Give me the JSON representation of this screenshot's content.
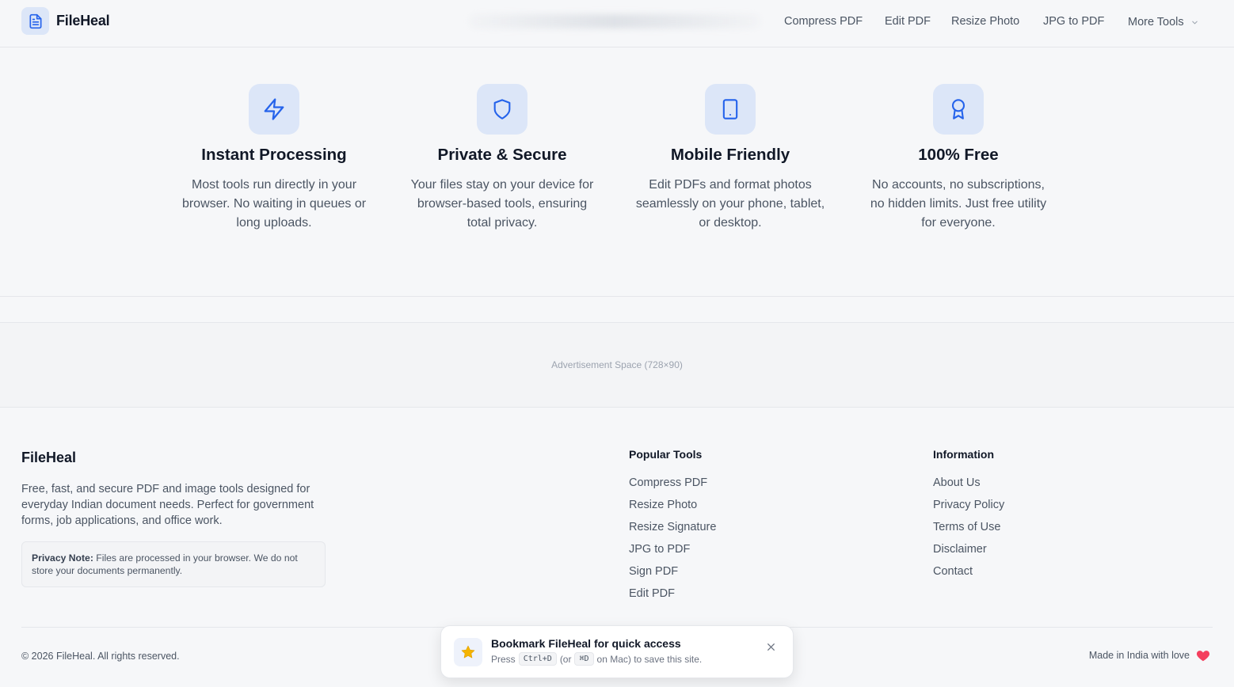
{
  "header": {
    "brand": "FileHeal",
    "nav": {
      "compress_pdf": "Compress PDF",
      "edit_pdf": "Edit PDF",
      "resize_photo": "Resize Photo",
      "jpg_to_pdf": "JPG to PDF",
      "more_tools": "More Tools"
    }
  },
  "features": [
    {
      "icon": "lightning-icon",
      "title": "Instant Processing",
      "desc_lines": [
        "Most tools run directly in your",
        "browser. No waiting in queues or",
        "long uploads."
      ]
    },
    {
      "icon": "shield-icon",
      "title": "Private & Secure",
      "desc_lines": [
        "Your files stay on your device for",
        "browser-based tools, ensuring",
        "total privacy."
      ]
    },
    {
      "icon": "tablet-icon",
      "title": "Mobile Friendly",
      "desc_lines": [
        "Edit PDFs and format photos",
        "seamlessly on your phone, tablet,",
        "or desktop."
      ]
    },
    {
      "icon": "award-icon",
      "title": "100% Free",
      "desc_lines": [
        "No accounts, no subscriptions,",
        "no hidden limits. Just free utility",
        "for everyone."
      ]
    }
  ],
  "ad": {
    "label": "Advertisement Space (728×90)"
  },
  "footer": {
    "brand": "FileHeal",
    "description_lines": [
      "Free, fast, and secure PDF and image tools designed for",
      "everyday Indian document needs. Perfect for government",
      "forms, job applications, and office work."
    ],
    "privacy_label": "Privacy Note:",
    "privacy_lines": [
      " Files are processed in your browser. We do not",
      "store your documents permanently."
    ],
    "popular_tools": {
      "title": "Popular Tools",
      "items": [
        "Compress PDF",
        "Resize Photo",
        "Resize Signature",
        "JPG to PDF",
        "Sign PDF",
        "Edit PDF"
      ]
    },
    "information": {
      "title": "Information",
      "items": [
        "About Us",
        "Privacy Policy",
        "Terms of Use",
        "Disclaimer",
        "Contact"
      ]
    },
    "copyright": "© 2026 FileHeal. All rights reserved.",
    "made_in": "Made in India with love"
  },
  "toast": {
    "title": "Bookmark FileHeal for quick access",
    "press": "Press",
    "key_windows": "Ctrl+D",
    "or": "(or",
    "key_mac": "⌘D",
    "suffix": "on Mac) to save this site."
  },
  "colors": {
    "accent": "#2563eb",
    "icon_bg": "#dce6f8",
    "heart": "#f43f5e",
    "star": "#f5b400"
  }
}
